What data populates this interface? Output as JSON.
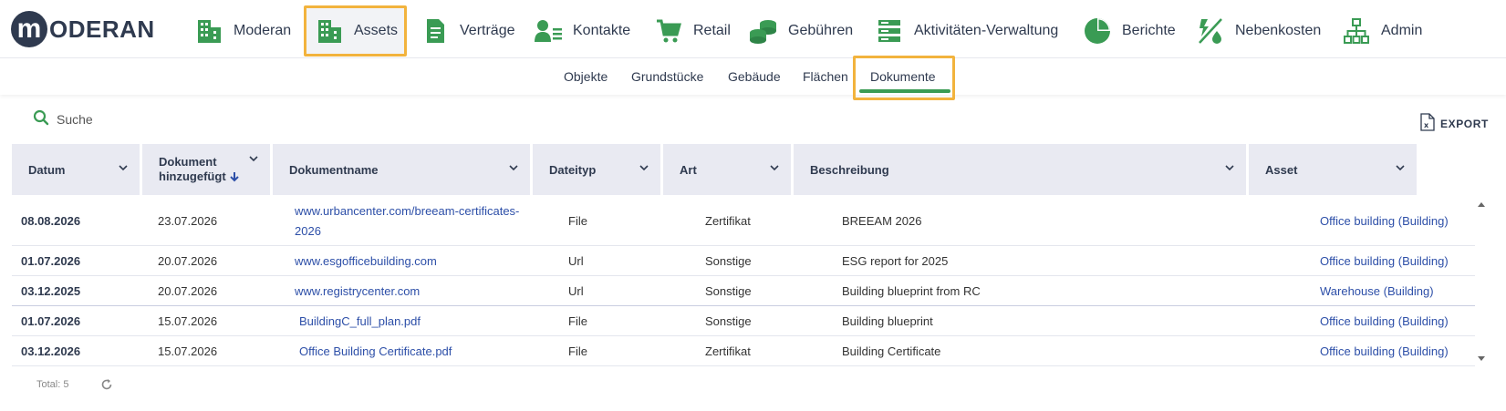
{
  "brand": {
    "initial": "m",
    "name": "ODERAN"
  },
  "nav": {
    "items": [
      {
        "label": "Moderan"
      },
      {
        "label": "Assets"
      },
      {
        "label": "Verträge"
      },
      {
        "label": "Kontakte"
      },
      {
        "label": "Retail"
      },
      {
        "label": "Gebühren"
      },
      {
        "label": "Aktivitäten-Verwaltung"
      },
      {
        "label": "Berichte"
      },
      {
        "label": "Nebenkosten"
      },
      {
        "label": "Admin"
      }
    ],
    "active_index": 1,
    "icon_color": "#3a9b54",
    "highlight_color": "#f2b33d"
  },
  "subnav": {
    "items": [
      {
        "label": "Objekte"
      },
      {
        "label": "Grundstücke"
      },
      {
        "label": "Gebäude"
      },
      {
        "label": "Flächen"
      },
      {
        "label": "Dokumente"
      }
    ],
    "active_index": 4
  },
  "toolbar": {
    "search_label": "Suche",
    "export_label": "EXPORT"
  },
  "table": {
    "columns": [
      {
        "label": "Datum"
      },
      {
        "label": "Dokument hinzugefügt"
      },
      {
        "label": "Dokumentname"
      },
      {
        "label": "Dateityp"
      },
      {
        "label": "Art"
      },
      {
        "label": "Beschreibung"
      },
      {
        "label": "Asset"
      }
    ],
    "sorted_column": "Dokument hinzugefügt",
    "sort_direction": "descending",
    "rows": [
      {
        "datum": "08.08.2026",
        "hinzugefuegt": "23.07.2026",
        "name_line1": "www.urbancenter.com/breeam-certificates-",
        "name_line2": "2026",
        "typ": "File",
        "art": "Zertifikat",
        "beschreibung": "BREEAM 2026",
        "asset": "Office building (Building)"
      },
      {
        "datum": "01.07.2026",
        "hinzugefuegt": "20.07.2026",
        "name": "www.esgofficebuilding.com",
        "typ": "Url",
        "art": "Sonstige",
        "beschreibung": "ESG report for 2025",
        "asset": "Office building (Building)"
      },
      {
        "datum": "03.12.2025",
        "hinzugefuegt": "20.07.2026",
        "name": "www.registrycenter.com",
        "typ": "Url",
        "art": "Sonstige",
        "beschreibung": "Building blueprint from RC",
        "asset": "Warehouse (Building)"
      },
      {
        "datum": "01.07.2026",
        "hinzugefuegt": "15.07.2026",
        "name": "BuildingC_full_plan.pdf",
        "typ": "File",
        "art": "Sonstige",
        "beschreibung": "Building blueprint",
        "asset": "Office building (Building)"
      },
      {
        "datum": "03.12.2026",
        "hinzugefuegt": "15.07.2026",
        "name": "Office Building Certificate.pdf",
        "typ": "File",
        "art": "Zertifikat",
        "beschreibung": "Building Certificate",
        "asset": "Office building (Building)"
      }
    ]
  },
  "footer": {
    "total_label": "Total: 5"
  }
}
